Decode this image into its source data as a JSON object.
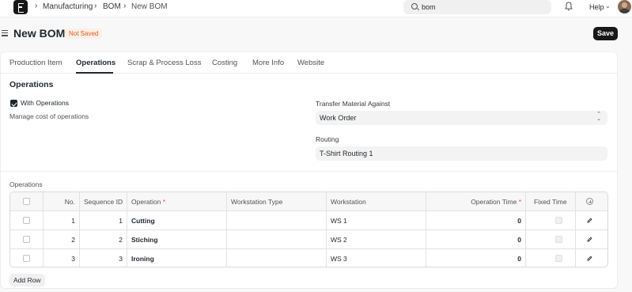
{
  "navbar": {
    "breadcrumbs": [
      "Manufacturing",
      "BOM",
      "New BOM"
    ],
    "search_value": "bom",
    "help_label": "Help"
  },
  "page": {
    "title": "New BOM",
    "status_badge": "Not Saved",
    "save_label": "Save"
  },
  "tabs": [
    "Production Item",
    "Operations",
    "Scrap & Process Loss",
    "Costing",
    "More Info",
    "Website"
  ],
  "active_tab": "Operations",
  "section": {
    "title": "Operations",
    "with_operations_label": "With Operations",
    "with_operations_checked": true,
    "with_operations_help": "Manage cost of operations",
    "transfer_label": "Transfer Material Against",
    "transfer_value": "Work Order",
    "routing_label": "Routing",
    "routing_value": "T-Shirt Routing 1"
  },
  "grid": {
    "label": "Operations",
    "headers": {
      "no": "No.",
      "sequence_id": "Sequence ID",
      "operation": "Operation",
      "workstation_type": "Workstation Type",
      "workstation": "Workstation",
      "operation_time": "Operation Time",
      "fixed_time": "Fixed Time"
    },
    "rows": [
      {
        "no": "1",
        "sequence_id": "1",
        "operation": "Cutting",
        "workstation_type": "",
        "workstation": "WS 1",
        "operation_time": "0"
      },
      {
        "no": "2",
        "sequence_id": "2",
        "operation": "Stiching",
        "workstation_type": "",
        "workstation": "WS 2",
        "operation_time": "0"
      },
      {
        "no": "3",
        "sequence_id": "3",
        "operation": "Ironing",
        "workstation_type": "",
        "workstation": "WS 3",
        "operation_time": "0"
      }
    ],
    "add_row_label": "Add Row"
  },
  "colors": {
    "primary_button": "#171717",
    "badge_text": "#e0591a",
    "badge_bg": "#fff0e6",
    "required_star": "#e24c4c"
  }
}
